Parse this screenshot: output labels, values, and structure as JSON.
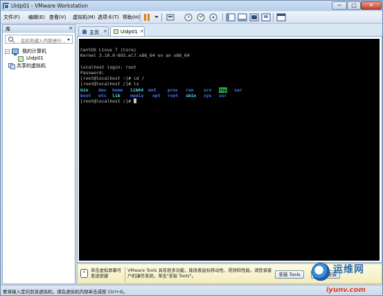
{
  "window": {
    "title": "Uidp01 - VMware Workstation",
    "controls": {
      "minimize": "─",
      "maximize": "□",
      "close": "✕"
    }
  },
  "menu": [
    {
      "label": "文件(F)"
    },
    {
      "label": "编辑(E)"
    },
    {
      "label": "查看(V)"
    },
    {
      "label": "虚拟机(M)"
    },
    {
      "label": "选项卡(T)"
    },
    {
      "label": "帮助(H)"
    }
  ],
  "library": {
    "title": "库",
    "close": "×",
    "search_placeholder": "在此处键入内容进行...",
    "tree": {
      "my_computer": "我的计算机",
      "vm": "Uidp01",
      "shared": "共享的虚拟机",
      "expanded_symbol": "−"
    }
  },
  "tabs": [
    {
      "label": "主页",
      "close": "×"
    },
    {
      "label": "Uidp01",
      "close": "×"
    }
  ],
  "console": {
    "lines": [
      "",
      "CentOS Linux 7 (Core)",
      "Kernel 3.10.0-693.el7.x86_64 on an x86_64",
      "",
      "localhost login: root",
      "Password:",
      "[root@localhost ~]# cd /",
      "[root@localhost /]# ls"
    ],
    "ls_row1": [
      "bin",
      "dev",
      "home",
      "lib64",
      "mnt",
      "proc",
      "run",
      "srv",
      "tmp",
      "var"
    ],
    "ls_row2": [
      "boot",
      "etc",
      "lib",
      "media",
      "opt",
      "root",
      "sbin",
      "sys",
      "usr"
    ],
    "prompt_final": "[root@localhost /]# ",
    "colors": {
      "text": "#c8c8c8",
      "directory": "#4b78ff",
      "symlink": "#4fe3e3",
      "tmp_bg": "#2fb02f",
      "tmp_fg": "#101070"
    }
  },
  "tools_bar": {
    "hint": "单击虚拟屏幕可发送按键",
    "message": "VMware Tools 具有很多功能，能改善鼠标移动性、视频和性能。请登录客户机操作系统，单击\"安装 Tools\"。",
    "install_button": "安装 Tools",
    "finish_button": "已完成安装"
  },
  "status_bar": {
    "message": "要将输入定向到该虚拟机，请在虚拟机内部单击或按 Ctrl+G。"
  },
  "watermark": {
    "chinese": "运维网",
    "domain": "iyunv.com"
  }
}
